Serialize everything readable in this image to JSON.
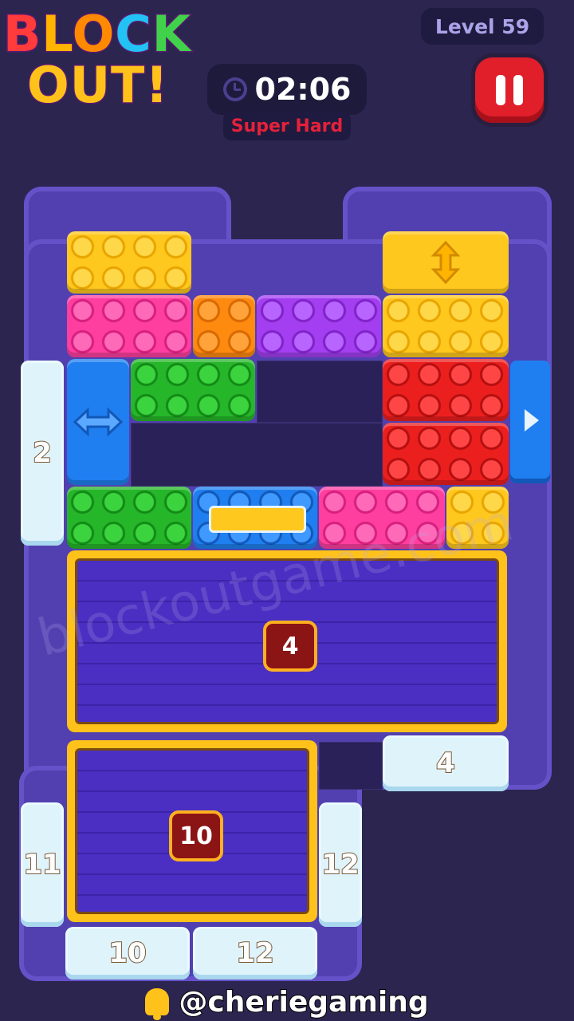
{
  "hud": {
    "logo_line1": [
      "B",
      "L",
      "O",
      "C",
      "K"
    ],
    "logo_line2": "OUT!",
    "level": "Level 59",
    "timer": "02:06",
    "difficulty": "Super Hard",
    "pause_icon": "pause-icon",
    "clock_icon": "clock-icon"
  },
  "gates": {
    "left_upper": "2",
    "right_lower": "4",
    "left_bottom": "11",
    "right_bottom": "12",
    "bottom_left": "10",
    "bottom_right": "12"
  },
  "crates": {
    "large": "4",
    "small": "10"
  },
  "watermark": "blockoutgame.com",
  "footer": {
    "handle": "@cheriegaming",
    "bell_icon": "bell-icon"
  },
  "colors": {
    "board": "#5240b0",
    "background": "#2b2550",
    "yellow": "#ffc81e",
    "pink": "#ff3fa0",
    "orange": "#ff8a10",
    "purple": "#a33ff0",
    "green": "#26b62a",
    "red": "#ec1f1f",
    "blue": "#1f7ff0",
    "pause_red": "#e01f2a",
    "difficulty_red": "#e5213a"
  }
}
